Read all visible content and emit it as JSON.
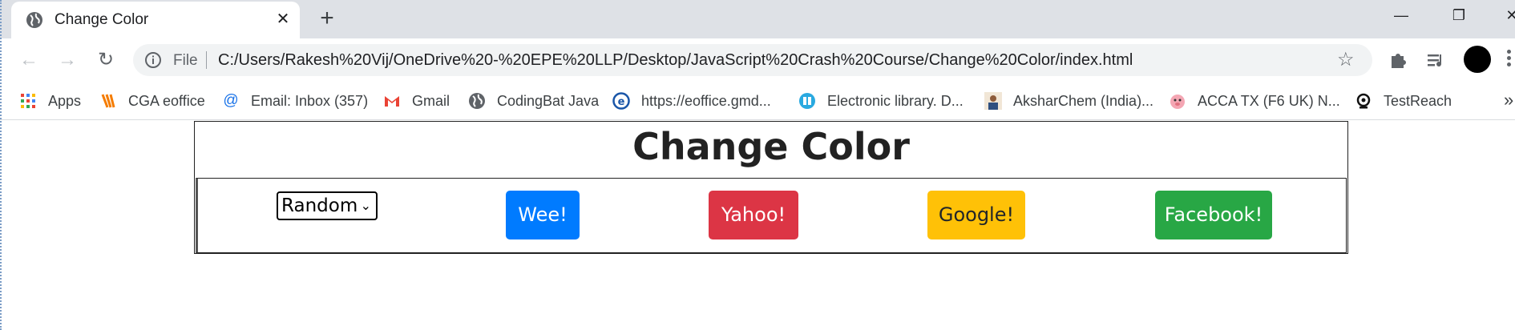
{
  "browser": {
    "tab": {
      "title": "Change Color",
      "favicon": "globe-icon",
      "close_icon": "close-icon"
    },
    "new_tab_icon": "plus-icon",
    "window_controls": [
      "minimize-icon",
      "restore-icon",
      "close-icon"
    ],
    "nav": {
      "back": "back-arrow-icon",
      "forward": "forward-arrow-icon",
      "reload": "reload-icon"
    },
    "address_bar": {
      "scheme_label": "File",
      "url": "C:/Users/Rakesh%20Vij/OneDrive%20-%20EPE%20LLP/Desktop/JavaScript%20Crash%20Course/Change%20Color/index.html",
      "bookmark_icon": "star-icon"
    },
    "toolbar_icons": [
      "extensions-icon",
      "media-icon",
      "profile-avatar",
      "menu-icon"
    ],
    "bookmarks": [
      {
        "label": "Apps",
        "icon": "apps-grid-icon"
      },
      {
        "label": "CGA eoffice",
        "icon": "cga-icon"
      },
      {
        "label": "Email: Inbox (357)",
        "icon": "at-icon"
      },
      {
        "label": "Gmail",
        "icon": "gmail-icon"
      },
      {
        "label": "CodingBat Java",
        "icon": "globe-icon"
      },
      {
        "label": "https://eoffice.gmd...",
        "icon": "e-icon"
      },
      {
        "label": "Electronic library. D...",
        "icon": "book-icon"
      },
      {
        "label": "AksharChem (India)...",
        "icon": "person-icon"
      },
      {
        "label": "ACCA TX (F6 UK) N...",
        "icon": "pig-icon"
      },
      {
        "label": "TestReach",
        "icon": "webcam-icon"
      }
    ],
    "bookmarks_more": "»"
  },
  "page": {
    "heading": "Change Color",
    "select": {
      "value": "Random",
      "options": [
        "Random"
      ]
    },
    "buttons": {
      "blue": "Wee!",
      "red": "Yahoo!",
      "yellow": "Google!",
      "green": "Facebook!"
    }
  },
  "colors": {
    "blue": "#007bff",
    "red": "#dc3545",
    "yellow": "#ffc107",
    "green": "#28a745"
  }
}
